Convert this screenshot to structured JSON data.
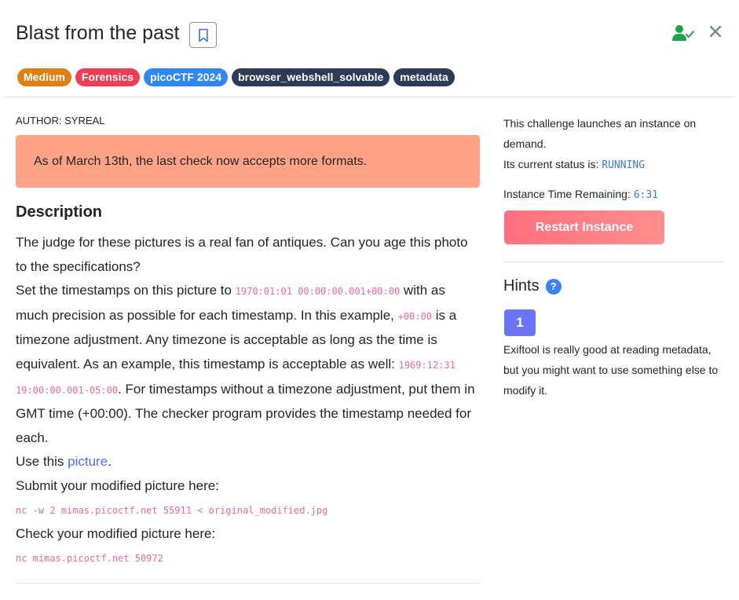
{
  "header": {
    "title": "Blast from the past"
  },
  "tags": [
    {
      "label": "Medium",
      "color": "#e07f16"
    },
    {
      "label": "Forensics",
      "color": "#ee3e57"
    },
    {
      "label": "picoCTF 2024",
      "color": "#2f86f5"
    },
    {
      "label": "browser_webshell_solvable",
      "color": "#2d3a58"
    },
    {
      "label": "metadata",
      "color": "#2d3a58"
    }
  ],
  "main": {
    "author": "AUTHOR: SYREAL",
    "alert": "As of March 13th, the last check now accepts more formats.",
    "description_heading": "Description",
    "p1": "The judge for these pictures is a real fan of antiques. Can you age this photo to the specifications?",
    "p2_a": "Set the timestamps on this picture to ",
    "p2_code1": "1970:01:01 00:00:00.001+00:00",
    "p2_b": " with as much precision as possible for each timestamp. In this example, ",
    "p2_code2": "+00:00",
    "p2_c": " is a timezone adjustment. Any timezone is acceptable as long as the time is equivalent. As an example, this timestamp is acceptable as well: ",
    "p2_code3": "1969:12:31 19:00:00.001-05:00",
    "p2_d": ". For timestamps without a timezone adjustment, put them in GMT time (+00:00). The checker program provides the timestamp needed for each.",
    "p3_a": "Use this ",
    "p3_link": "picture",
    "p3_b": ".",
    "p4": "Submit your modified picture here:",
    "cmd1": "nc -w 2 mimas.picoctf.net 55911 < original_modified.jpg",
    "p5": "Check your modified picture here:",
    "cmd2": "nc mimas.picoctf.net 50972"
  },
  "side": {
    "launch_text": "This challenge launches an instance on demand.",
    "status_label": "Its current status is: ",
    "status_value": "RUNNING",
    "time_label": "Instance Time Remaining: ",
    "time_value": "6:31",
    "restart_label": "Restart Instance",
    "hints_heading": "Hints",
    "help_glyph": "?",
    "hint_number": "1",
    "hint_text": "Exiftool is really good at reading metadata, but you might want to use something else to modify it."
  },
  "icons": {
    "bookmark": "bookmark-icon",
    "user_check": "user-check-icon",
    "close": "close-icon",
    "help": "help-icon"
  }
}
